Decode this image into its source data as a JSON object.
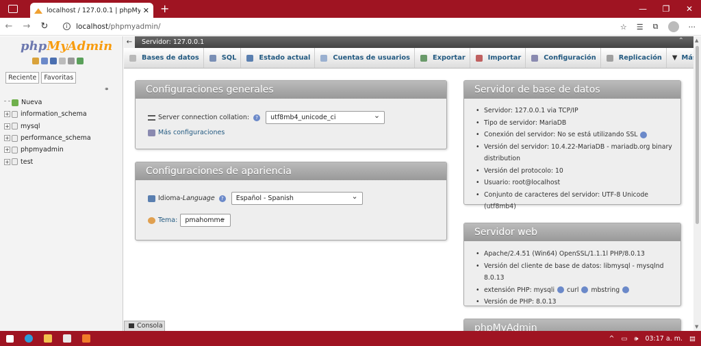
{
  "browser": {
    "tab_title": "localhost / 127.0.0.1 | phpMyAdmin",
    "tab_close": "✕",
    "new_tab": "+",
    "url_host": "localhost",
    "url_path": "/phpmyadmin/"
  },
  "nav": {
    "logo_php": "php",
    "logo_ma": "MyAdmin",
    "tabs": [
      "Reciente",
      "Favoritas"
    ],
    "tree": [
      {
        "label": "Nueva",
        "type": "new"
      },
      {
        "label": "information_schema",
        "type": "db"
      },
      {
        "label": "mysql",
        "type": "db"
      },
      {
        "label": "performance_schema",
        "type": "db"
      },
      {
        "label": "phpmyadmin",
        "type": "db"
      },
      {
        "label": "test",
        "type": "db"
      }
    ]
  },
  "serverbar": {
    "label": "Servidor: 127.0.0.1"
  },
  "menu": [
    {
      "label": "Bases de datos",
      "color": "#b9b9b9"
    },
    {
      "label": "SQL",
      "color": "#7a8fb5"
    },
    {
      "label": "Estado actual",
      "color": "#5a7fb0"
    },
    {
      "label": "Cuentas de usuarios",
      "color": "#9ab0d0"
    },
    {
      "label": "Exportar",
      "color": "#6a9a6a"
    },
    {
      "label": "Importar",
      "color": "#c06060"
    },
    {
      "label": "Configuración",
      "color": "#8a8ab0"
    },
    {
      "label": "Replicación",
      "color": "#a0a0a0"
    },
    {
      "label": "Más",
      "color": "#555555"
    }
  ],
  "general": {
    "title": "Configuraciones generales",
    "collation_label": "Server connection collation:",
    "collation_value": "utf8mb4_unicode_ci",
    "more_link": "Más configuraciones"
  },
  "appearance": {
    "title": "Configuraciones de apariencia",
    "language_label": "Idioma",
    "language_sep": " - ",
    "language_label_en": "Language",
    "language_value": "Español - Spanish",
    "theme_label": "Tema:",
    "theme_value": "pmahomme"
  },
  "db_server": {
    "title": "Servidor de base de datos",
    "items": [
      "Servidor: 127.0.0.1 via TCP/IP",
      "Tipo de servidor: MariaDB",
      "Conexión del servidor: No se está utilizando SSL",
      "Versión del servidor: 10.4.22-MariaDB - mariadb.org binary distribution",
      "Versión del protocolo: 10",
      "Usuario: root@localhost",
      "Conjunto de caracteres del servidor: UTF-8 Unicode (utf8mb4)"
    ]
  },
  "web_server": {
    "title": "Servidor web",
    "items": [
      "Apache/2.4.51 (Win64) OpenSSL/1.1.1l PHP/8.0.13",
      "Versión del cliente de base de datos: libmysql - mysqlnd 8.0.13",
      "extensión PHP: mysqli",
      "Versión de PHP: 8.0.13"
    ],
    "ext_curl": "curl",
    "ext_mbstring": "mbstring"
  },
  "pma_card": {
    "title": "phpMyAdmin"
  },
  "console": {
    "label": "Consola"
  },
  "taskbar": {
    "time": "03:17 a. m."
  }
}
